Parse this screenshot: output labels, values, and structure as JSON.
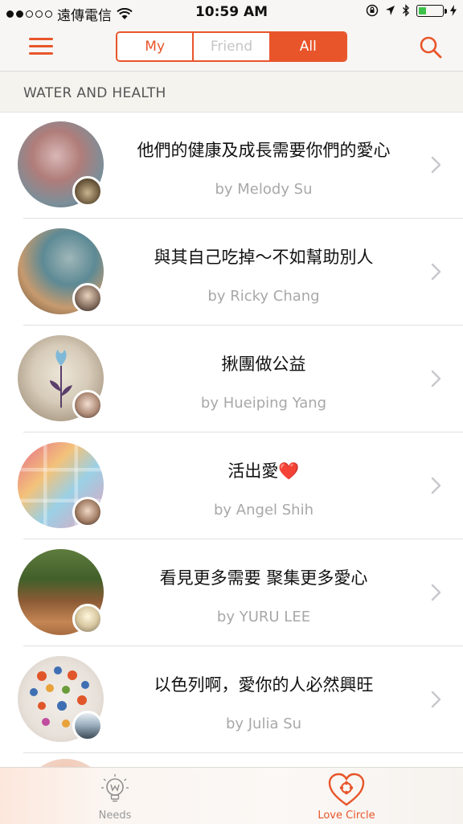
{
  "status_bar": {
    "carrier": "遠傳電信",
    "time": "10:59 AM",
    "battery_level": 0.35
  },
  "nav": {
    "segments": [
      "My",
      "Friend",
      "All"
    ],
    "selected": "All"
  },
  "section": {
    "title": "WATER AND HEALTH"
  },
  "items": [
    {
      "title": "他們的健康及成長需要你們的愛心",
      "author": "by Melody Su"
    },
    {
      "title": "與其自己吃掉～不如幫助別人",
      "author": "by Ricky Chang"
    },
    {
      "title": "揪團做公益",
      "author": "by Hueiping Yang"
    },
    {
      "title": "活出愛❤️",
      "author": "by Angel Shih"
    },
    {
      "title": "看見更多需要 聚集更多愛心",
      "author": "by YURU LEE"
    },
    {
      "title": "以色列啊，愛你的人必然興旺",
      "author": "by Julia Su"
    }
  ],
  "tabbar": {
    "needs": "Needs",
    "love_circle": "Love Circle",
    "selected": "Love Circle"
  },
  "colors": {
    "accent": "#e8552a",
    "muted": "#a8a8a8"
  }
}
